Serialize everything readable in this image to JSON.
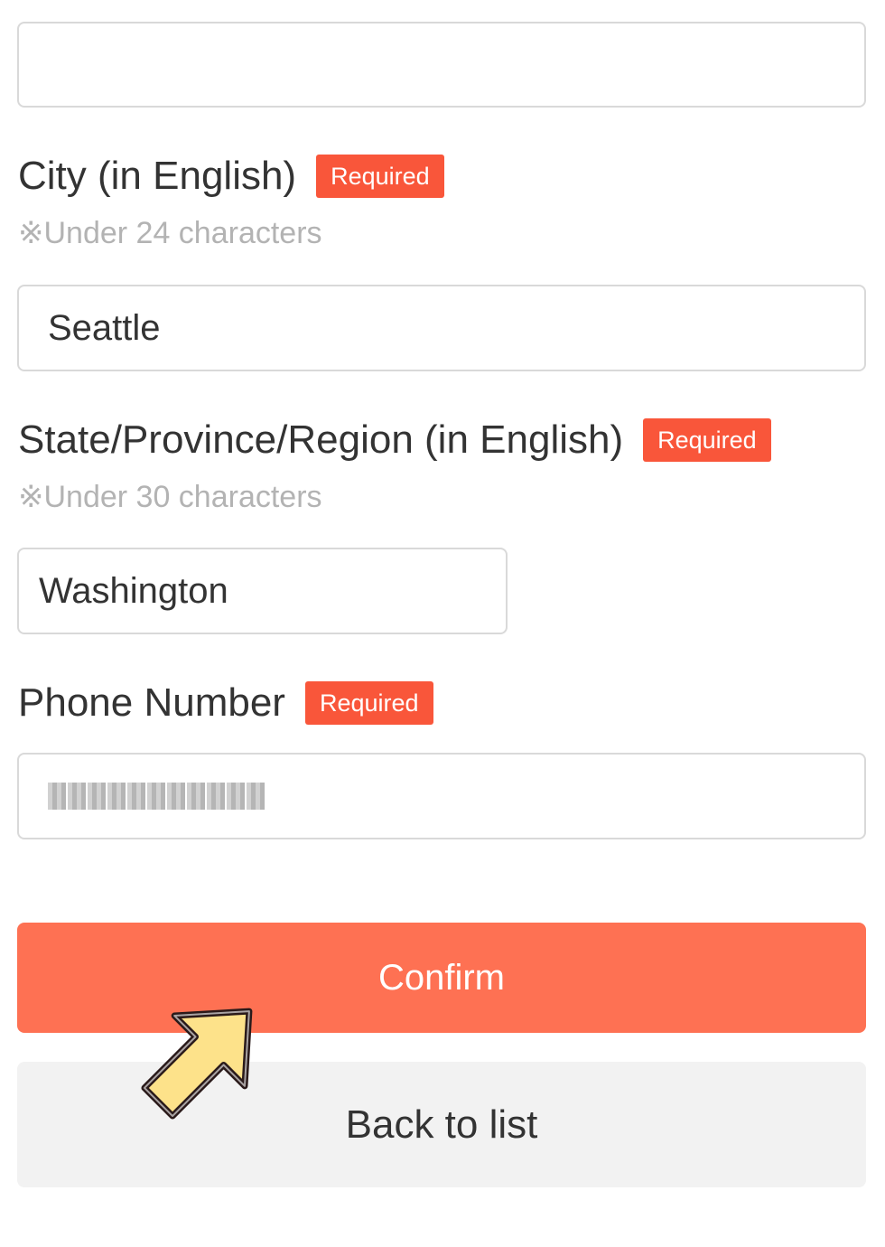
{
  "form": {
    "address_field": {
      "value": ""
    },
    "city": {
      "label": "City (in English)",
      "badge": "Required",
      "hint": "※Under 24 characters",
      "value": "Seattle"
    },
    "state": {
      "label": "State/Province/Region (in English)",
      "badge": "Required",
      "hint": "※Under 30 characters",
      "value": "Washington"
    },
    "phone": {
      "label": "Phone Number",
      "badge": "Required",
      "value_obscured": true
    }
  },
  "actions": {
    "confirm_label": "Confirm",
    "back_label": "Back to list"
  },
  "colors": {
    "required_badge": "#f9563a",
    "confirm_button": "#fe7153",
    "back_button": "#f2f2f2",
    "hint_text": "#b3b3b3",
    "pointer_arrow_fill": "#fde28a"
  },
  "icons": {
    "pointer": "arrow-pointer-icon"
  }
}
